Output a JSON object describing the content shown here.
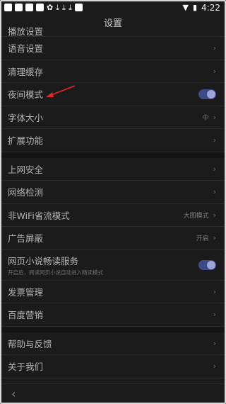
{
  "status": {
    "time": "4:22"
  },
  "title": "设置",
  "items_group1": [
    {
      "label": "播放设置",
      "type": "chevron"
    },
    {
      "label": "语音设置",
      "type": "chevron"
    },
    {
      "label": "清理缓存",
      "type": "chevron"
    },
    {
      "label": "夜间模式",
      "type": "toggle",
      "on": true
    },
    {
      "label": "字体大小",
      "value": "中",
      "type": "chevron"
    },
    {
      "label": "扩展功能",
      "type": "chevron"
    }
  ],
  "items_group2": [
    {
      "label": "上网安全",
      "type": "chevron"
    },
    {
      "label": "网络检测",
      "type": "chevron"
    },
    {
      "label": "非WiFi省流模式",
      "value": "大图模式",
      "type": "chevron"
    },
    {
      "label": "广告屏蔽",
      "value": "开启",
      "type": "chevron"
    },
    {
      "label": "网页小说畅读服务",
      "sub": "开启后，阅读网页小说自动进入畅读模式",
      "type": "toggle",
      "on": true
    },
    {
      "label": "发票管理",
      "type": "chevron"
    },
    {
      "label": "百度营销",
      "type": "chevron"
    }
  ],
  "items_group3": [
    {
      "label": "帮助与反馈",
      "type": "chevron"
    },
    {
      "label": "关于我们",
      "type": "chevron"
    }
  ],
  "colors": {
    "accent": "#3d4a8a",
    "knob": "#9ba6d6",
    "background": "#1b1b1c",
    "annotation": "#e0282b"
  }
}
